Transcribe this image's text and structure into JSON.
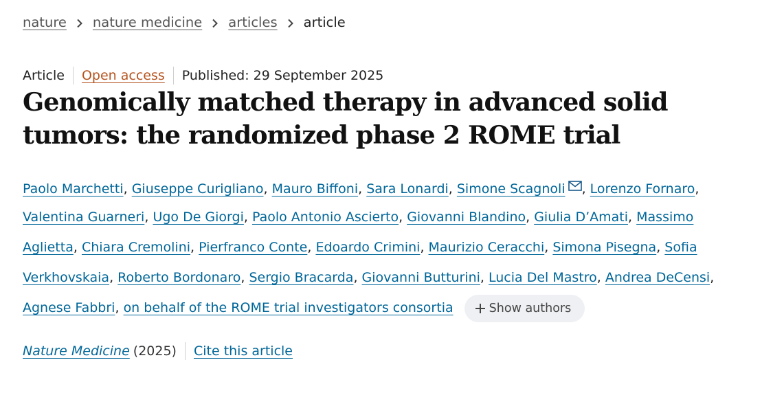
{
  "breadcrumb": {
    "items": [
      "nature",
      "nature medicine",
      "articles"
    ],
    "current": "article"
  },
  "meta": {
    "type": "Article",
    "access": "Open access",
    "published": "Published: 29 September 2025"
  },
  "title": {
    "line1": "Genomically matched therapy in advanced solid",
    "line2": "tumors: the randomized phase 2 ROME trial"
  },
  "authors": [
    "Paolo Marchetti",
    "Giuseppe Curigliano",
    "Mauro Biffoni",
    "Sara Lonardi",
    "Simone Scagnoli",
    "Lorenzo Fornaro",
    "Valentina Guarneri",
    "Ugo De Giorgi",
    "Paolo Antonio Ascierto",
    "Giovanni Blandino",
    "Giulia D’Amati",
    "Massimo Aglietta",
    "Chiara Cremolini",
    "Pierfranco Conte",
    "Edoardo Crimini",
    "Maurizio Ceracchi",
    "Simona Pisegna",
    "Sofia Verkhovskaia",
    "Roberto Bordonaro",
    "Sergio Bracarda",
    "Giovanni Butturini",
    "Lucia Del Mastro",
    "Andrea DeCensi",
    "Agnese Fabbri",
    "on behalf of the ROME trial investigators consortia"
  ],
  "author_fragments": {
    "massimo": "Massimo",
    "aglietta": "Aglietta",
    "sofia": "Sofia",
    "verkhovskaia": "Verkhovskaia"
  },
  "separator": ",",
  "corresponding_icon": "mail-icon",
  "show_authors": {
    "icon": "plus-icon",
    "label": "Show authors"
  },
  "citation": {
    "journal": "Nature Medicine",
    "year": "(2025)",
    "cite_label": "Cite this article"
  },
  "colors": {
    "link": "#006699",
    "open_access": "#b5541f",
    "text": "#222222",
    "pill_bg": "#eef0f3"
  }
}
